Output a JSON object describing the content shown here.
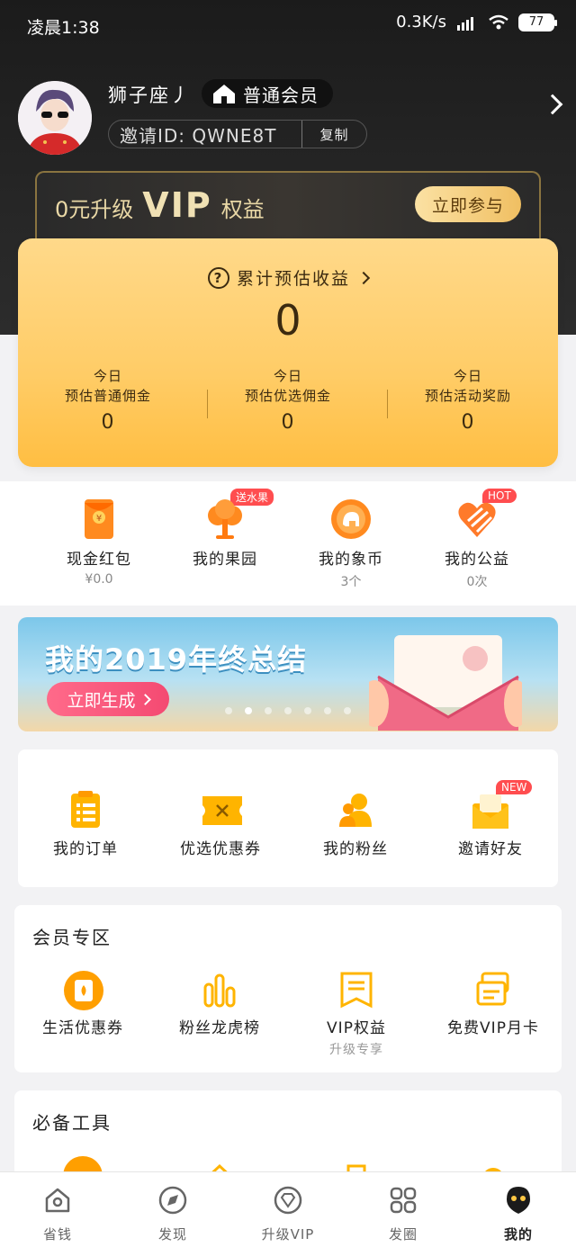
{
  "status_bar": {
    "time": "凌晨1:38",
    "net_speed": "0.3K/s",
    "battery": "77"
  },
  "profile": {
    "nickname": "狮子座丿",
    "member_level": "普通会员",
    "invite_label": "邀请ID: QWNE8T",
    "copy_label": "复制"
  },
  "vip_strip": {
    "prefix": "0元升级",
    "vip": "VIP",
    "suffix": "权益",
    "join_label": "立即参与"
  },
  "earnings": {
    "title": "累计预估收益",
    "total": "0",
    "columns": [
      {
        "line1": "今日",
        "line2": "预估普通佣金",
        "value": "0"
      },
      {
        "line1": "今日",
        "line2": "预估优选佣金",
        "value": "0"
      },
      {
        "line1": "今日",
        "line2": "预估活动奖励",
        "value": "0"
      }
    ]
  },
  "quick": [
    {
      "label": "现金红包",
      "sub": "¥0.0",
      "icon": "red-envelope-icon"
    },
    {
      "label": "我的果园",
      "sub": "",
      "tag": "送水果",
      "icon": "tree-icon"
    },
    {
      "label": "我的象币",
      "sub": "3个",
      "icon": "elephant-coin-icon"
    },
    {
      "label": "我的公益",
      "sub": "0次",
      "tag": "HOT",
      "icon": "heart-charity-icon"
    }
  ],
  "banner": {
    "title": "我的2019年终总结",
    "button": "立即生成"
  },
  "orders": [
    {
      "label": "我的订单",
      "icon": "order-list-icon"
    },
    {
      "label": "优选优惠券",
      "icon": "coupon-icon"
    },
    {
      "label": "我的粉丝",
      "icon": "fans-icon"
    },
    {
      "label": "邀请好友",
      "tag": "NEW",
      "icon": "invite-envelope-icon"
    }
  ],
  "member_zone": {
    "title": "会员专区",
    "items": [
      {
        "label": "生活优惠券",
        "sub": "",
        "icon": "life-coupon-icon"
      },
      {
        "label": "粉丝龙虎榜",
        "sub": "",
        "icon": "ranking-bars-icon"
      },
      {
        "label": "VIP权益",
        "sub": "升级专享",
        "icon": "vip-rights-icon"
      },
      {
        "label": "免费VIP月卡",
        "sub": "",
        "icon": "vip-card-icon"
      }
    ]
  },
  "tools": {
    "title": "必备工具"
  },
  "tabbar": [
    {
      "label": "省钱",
      "icon": "home-icon"
    },
    {
      "label": "发现",
      "icon": "compass-icon"
    },
    {
      "label": "升级VIP",
      "icon": "diamond-icon"
    },
    {
      "label": "发圈",
      "icon": "grid-icon"
    },
    {
      "label": "我的",
      "icon": "user-icon",
      "active": true
    }
  ],
  "colors": {
    "accent": "#ffc844",
    "dark": "#1b1b1b",
    "gold_text": "#e9d8a6",
    "brand_orange": "#ff9f00"
  }
}
